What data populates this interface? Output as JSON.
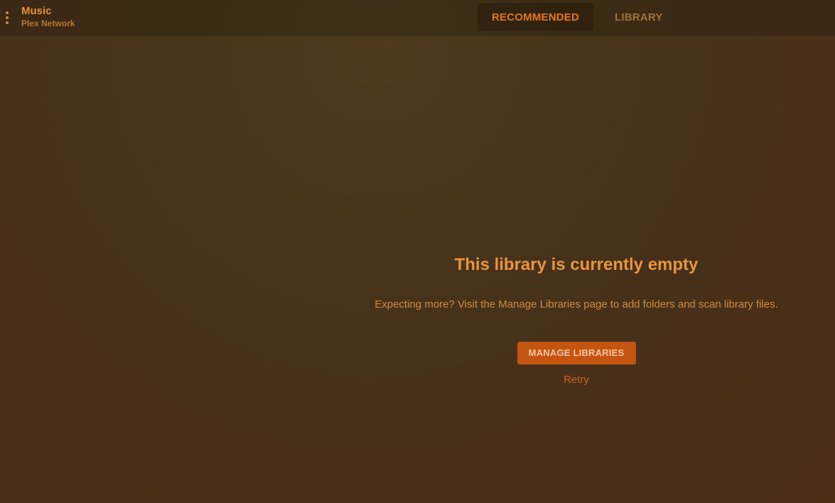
{
  "header": {
    "title": "Music",
    "subtitle": "Plex Network",
    "menu_icon": "more-vertical-icon"
  },
  "tabs": [
    {
      "label": "RECOMMENDED",
      "active": true
    },
    {
      "label": "LIBRARY",
      "active": false
    }
  ],
  "empty_state": {
    "title": "This library is currently empty",
    "description": "Expecting more? Visit the Manage Libraries page to add folders and scan library files.",
    "button_label": "MANAGE LIBRARIES",
    "retry_label": "Retry"
  },
  "colors": {
    "accent": "#e5751d",
    "button": "#c55411",
    "background": "#47341a"
  }
}
